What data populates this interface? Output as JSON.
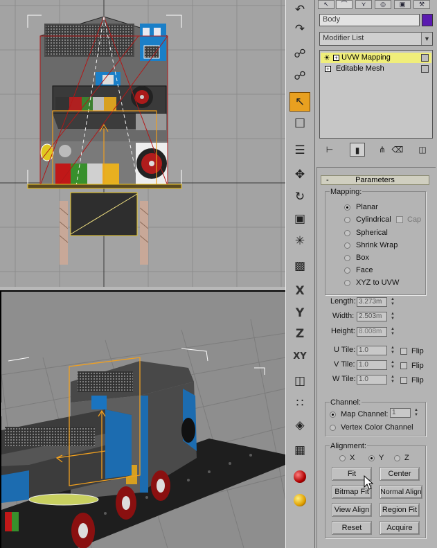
{
  "command_panel": {
    "object_name": "Body",
    "object_color": "#5a1ab0",
    "modifier_list_label": "Modifier List",
    "stack": [
      {
        "label": "UVW Mapping",
        "selected": true
      },
      {
        "label": "Editable Mesh",
        "selected": false
      }
    ],
    "tab_icons": [
      "create-icon",
      "modify-icon",
      "hierarchy-icon",
      "motion-icon",
      "display-icon",
      "utilities-icon"
    ]
  },
  "parameters": {
    "rollout_title": "Parameters",
    "collapse_symbol": "-",
    "mapping": {
      "title": "Mapping:",
      "options": [
        "Planar",
        "Cylindrical",
        "Spherical",
        "Shrink Wrap",
        "Box",
        "Face",
        "XYZ to UVW"
      ],
      "selected": "Planar",
      "cap_label": "Cap"
    },
    "dimensions": {
      "length_label": "Length:",
      "length_value": "3.273m",
      "width_label": "Width:",
      "width_value": "2.503m",
      "height_label": "Height:",
      "height_value": "8.008m"
    },
    "tiles": {
      "u_label": "U Tile:",
      "u_value": "1.0",
      "v_label": "V Tile:",
      "v_value": "1.0",
      "w_label": "W Tile:",
      "w_value": "1.0",
      "flip_label": "Flip"
    },
    "channel": {
      "title": "Channel:",
      "map_channel_label": "Map Channel:",
      "map_channel_value": "1",
      "vertex_color_label": "Vertex Color Channel",
      "selected": "Map Channel"
    },
    "alignment": {
      "title": "Alignment:",
      "axes": [
        "X",
        "Y",
        "Z"
      ],
      "selected_axis": "Y",
      "buttons": {
        "fit": "Fit",
        "center": "Center",
        "bitmap_fit": "Bitmap Fit",
        "normal_align": "Normal Align",
        "view_align": "View Align",
        "region_fit": "Region Fit",
        "reset": "Reset",
        "acquire": "Acquire"
      }
    }
  },
  "toolbar": {
    "axis_x": "X",
    "axis_y": "Y",
    "axis_z": "Z",
    "axis_xy": "XY",
    "active_tool": "select-object"
  }
}
